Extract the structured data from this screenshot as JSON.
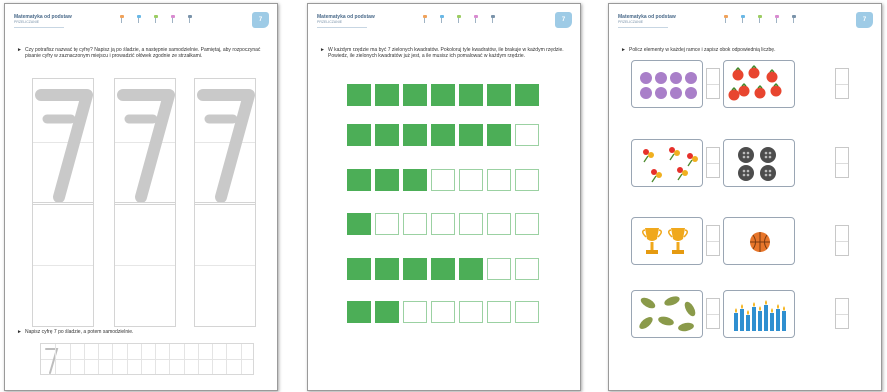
{
  "header": {
    "title": "Matematyka od podstaw",
    "subtitle": "PRZELICZANIE",
    "badge": "7",
    "nav_colors": [
      "#f0a25a",
      "#69b8e6",
      "#9ccd62",
      "#d98bd0",
      "#7a93aa"
    ]
  },
  "page1": {
    "instruction_1": "Czy potrafisz nazwać tę cyfrę? Napisz ją po śladzie, a następnie samodzielnie. Pamiętaj, aby rozpoczynać pisanie cyfry w zaznaczonym miejscu i prowadzić ołówek zgodnie ze strzałkami.",
    "digit": "7",
    "instruction_2": "Napisz cyfrę 7 po śladzie, a potem samodzielnie.",
    "trace_digit": "7"
  },
  "page2": {
    "instruction": "W każdym rzędzie ma być 7 zielonych kwadratów. Pokoloruj tyle kwadratów, ile brakuje w każdym rzędzie. Powiedz, ile zielonych kwadratów już jest, a ile musisz ich pomalować w każdym rzędzie.",
    "total_per_row": 7,
    "filled_counts": [
      7,
      6,
      3,
      1,
      5,
      2
    ],
    "colors": {
      "filled": "#4cae57",
      "empty_border": "#9bd1a2"
    }
  },
  "page3": {
    "instruction": "Policz elementy w każdej ramce i zapisz obok odpowiednią liczbę.",
    "frames": [
      {
        "item": "purple-dot-icon",
        "count": 8
      },
      {
        "item": "tomato-icon",
        "count": 7
      },
      {
        "item": "flower-icon",
        "count": 5
      },
      {
        "item": "button-icon",
        "count": 4
      },
      {
        "item": "trophy-icon",
        "count": 2
      },
      {
        "item": "basketball-icon",
        "count": 1
      },
      {
        "item": "leaf-icon",
        "count": 6
      },
      {
        "item": "candle-icon",
        "count": 9
      }
    ]
  }
}
